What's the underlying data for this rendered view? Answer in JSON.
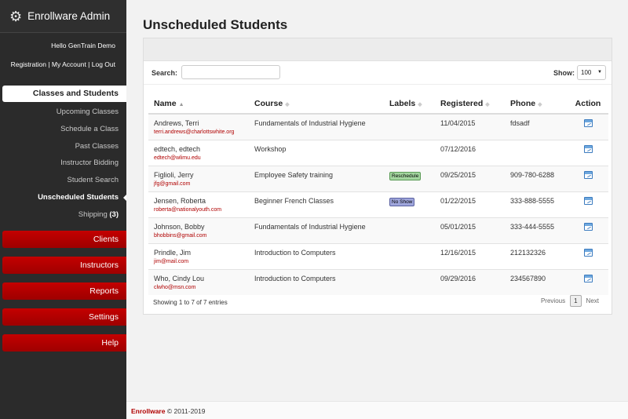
{
  "sidebar": {
    "brand_title": "Enrollware Admin",
    "greeting": "Hello GenTrain Demo",
    "links": [
      "Registration",
      "My Account",
      "Log Out"
    ],
    "section_heading": "Classes and Students",
    "submenu": [
      {
        "label": "Upcoming Classes"
      },
      {
        "label": "Schedule a Class"
      },
      {
        "label": "Past Classes"
      },
      {
        "label": "Instructor Bidding"
      },
      {
        "label": "Student Search"
      },
      {
        "label": "Unscheduled Students",
        "active": true
      },
      {
        "label": "Shipping",
        "count": "(3)"
      }
    ],
    "menu_buttons": [
      "Clients",
      "Instructors",
      "Reports",
      "Settings",
      "Help"
    ]
  },
  "main": {
    "page_title": "Unscheduled Students",
    "search_label": "Search:",
    "search_value": "",
    "show_label": "Show:",
    "show_value": "100",
    "columns": [
      "Name",
      "Course",
      "Labels",
      "Registered",
      "Phone",
      "Action"
    ],
    "rows": [
      {
        "name": "Andrews, Terri",
        "email": "terri.andrews@charlottswhite.org",
        "course": "Fundamentals of Industrial Hygiene",
        "label": "",
        "registered": "11/04/2015",
        "phone": "fdsadf"
      },
      {
        "name": "edtech, edtech",
        "email": "edtech@wlimu.edu",
        "course": "Workshop",
        "label": "",
        "registered": "07/12/2016",
        "phone": ""
      },
      {
        "name": "Figlioli, Jerry",
        "email": "jfg@gmail.com",
        "course": "Employee Safety training",
        "label": "Reschedule",
        "label_color": "#a4d6a0",
        "registered": "09/25/2015",
        "phone": "909-780-6288"
      },
      {
        "name": "Jensen, Roberta",
        "email": "roberta@nationalyouth.com",
        "course": "Beginner French Classes",
        "label": "No Show",
        "label_color": "#9fa6dc",
        "registered": "01/22/2015",
        "phone": "333-888-5555"
      },
      {
        "name": "Johnson, Bobby",
        "email": "bhobbins@gmail.com",
        "course": "Fundamentals of Industrial Hygiene",
        "label": "",
        "registered": "05/01/2015",
        "phone": "333-444-5555"
      },
      {
        "name": "Prindle, Jim",
        "email": "jim@mail.com",
        "course": "Introduction to Computers",
        "label": "",
        "registered": "12/16/2015",
        "phone": "212132326"
      },
      {
        "name": "Who, Cindy Lou",
        "email": "clwho@msn.com",
        "course": "Introduction to Computers",
        "label": "",
        "registered": "09/29/2016",
        "phone": "234567890"
      }
    ],
    "showing_text": "Showing 1 to 7 of 7 entries",
    "pager": {
      "previous": "Previous",
      "current": "1",
      "next": "Next"
    }
  },
  "footer": {
    "brand": "Enrollware",
    "copyright": "© 2011-2019"
  },
  "colors": {
    "accent_red": "#b00000",
    "sidebar_bg": "#2b2b2b",
    "reschedule_badge": "#a4d6a0",
    "noshow_badge": "#9fa6dc"
  }
}
